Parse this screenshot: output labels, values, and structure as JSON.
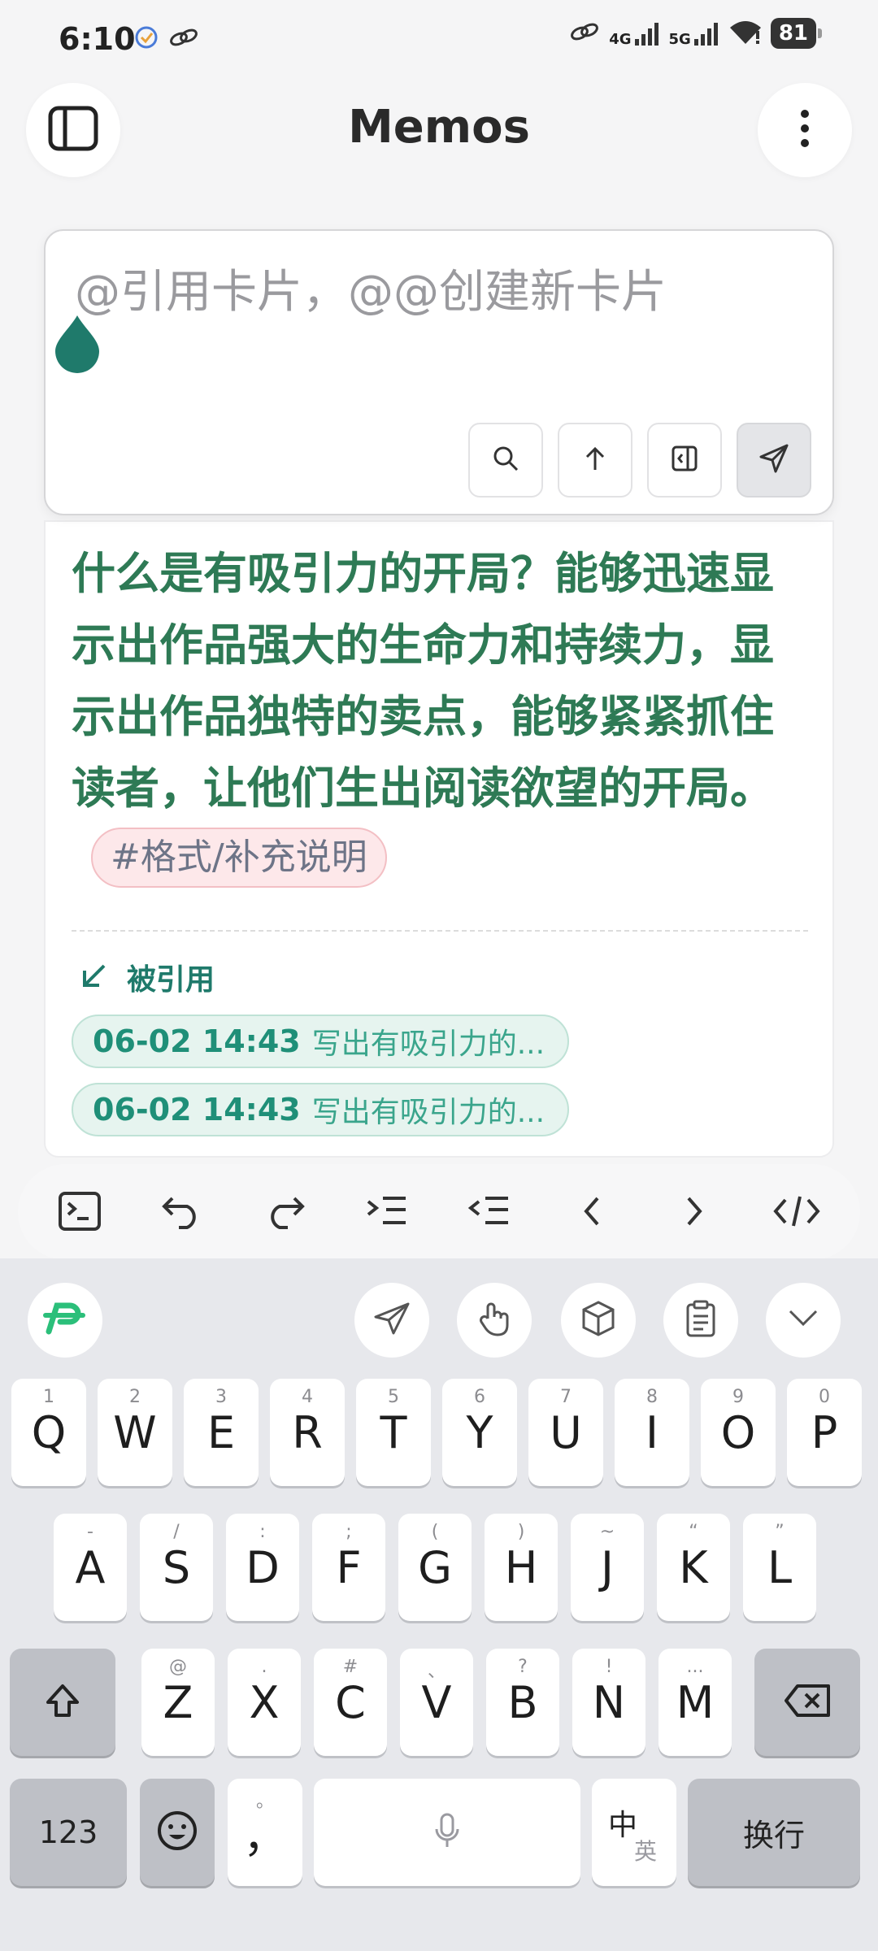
{
  "status": {
    "time": "6:10",
    "net1": "4G",
    "net2": "5G",
    "battery": "81"
  },
  "app": {
    "title": "Memos"
  },
  "editor": {
    "placeholder": "@引用卡片，@@创建新卡片"
  },
  "memo": {
    "content": "什么是有吸引力的开局？能够迅速显示出作品强大的生命力和持续力，显示出作品独特的卖点，能够紧紧抓住读者，让他们生出阅读欲望的开局。",
    "tag": "#格式/补充说明",
    "referenced_label": "被引用",
    "references": [
      {
        "date": "06-02 14:43",
        "title": "写出有吸引力的..."
      },
      {
        "date": "06-02 14:43",
        "title": "写出有吸引力的..."
      }
    ]
  },
  "keyboard": {
    "row1": [
      {
        "k": "Q",
        "s": "1"
      },
      {
        "k": "W",
        "s": "2"
      },
      {
        "k": "E",
        "s": "3"
      },
      {
        "k": "R",
        "s": "4"
      },
      {
        "k": "T",
        "s": "5"
      },
      {
        "k": "Y",
        "s": "6"
      },
      {
        "k": "U",
        "s": "7"
      },
      {
        "k": "I",
        "s": "8"
      },
      {
        "k": "O",
        "s": "9"
      },
      {
        "k": "P",
        "s": "0"
      }
    ],
    "row2": [
      {
        "k": "A",
        "s": "-"
      },
      {
        "k": "S",
        "s": "/"
      },
      {
        "k": "D",
        "s": ":"
      },
      {
        "k": "F",
        "s": ";"
      },
      {
        "k": "G",
        "s": "("
      },
      {
        "k": "H",
        "s": ")"
      },
      {
        "k": "J",
        "s": "~"
      },
      {
        "k": "K",
        "s": "“"
      },
      {
        "k": "L",
        "s": "”"
      }
    ],
    "row3": [
      {
        "k": "Z",
        "s": "@"
      },
      {
        "k": "X",
        "s": "."
      },
      {
        "k": "C",
        "s": "#"
      },
      {
        "k": "V",
        "s": "、"
      },
      {
        "k": "B",
        "s": "?"
      },
      {
        "k": "N",
        "s": "!"
      },
      {
        "k": "M",
        "s": "..."
      }
    ],
    "num_label": "123",
    "comma_label": "，",
    "comma_sub": "。",
    "lang_main": "中",
    "lang_sub": "英",
    "enter_label": "换行"
  },
  "colors": {
    "accent": "#2e7a55",
    "teal": "#1f8f78"
  }
}
